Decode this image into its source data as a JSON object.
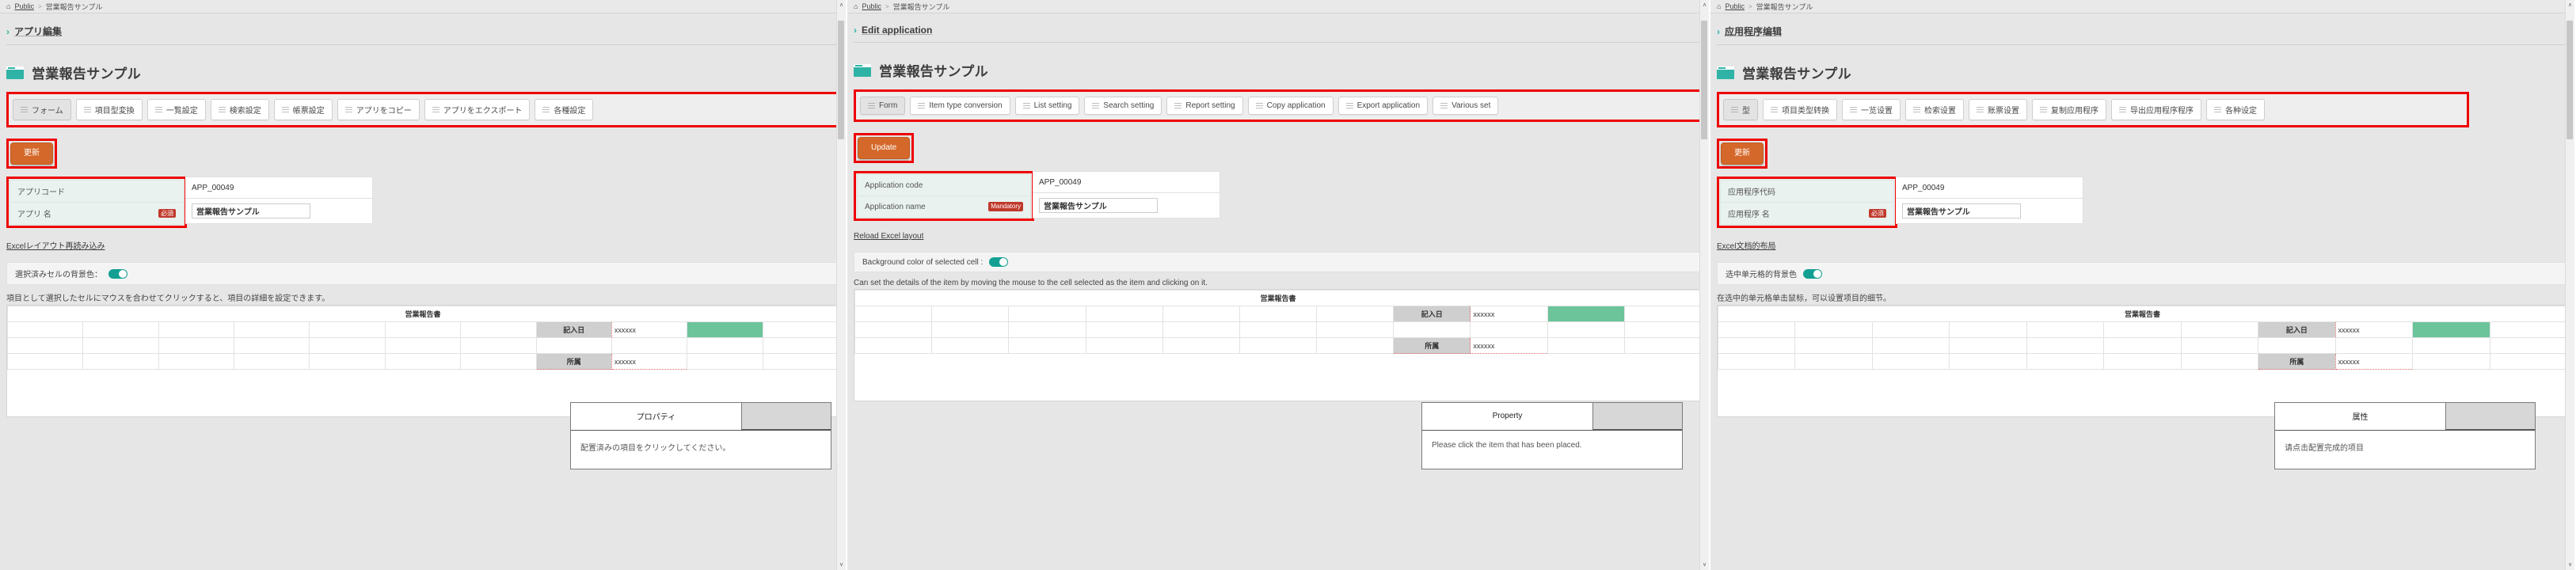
{
  "panels": [
    {
      "id": "ja",
      "breadcrumb": {
        "home_icon": "home-icon",
        "root": "Public",
        "separator": ">",
        "current": "営業報告サンプル"
      },
      "section": {
        "chevron": "chevron-right-icon",
        "title": "アプリ編集"
      },
      "app": {
        "icon": "window-icon",
        "title": "営業報告サンプル"
      },
      "toolbar": {
        "buttons": [
          {
            "label": "フォーム",
            "active": true
          },
          {
            "label": "項目型変換",
            "active": false
          },
          {
            "label": "一覧設定",
            "active": false
          },
          {
            "label": "検索設定",
            "active": false
          },
          {
            "label": "帳票設定",
            "active": false
          },
          {
            "label": "アプリをコピー",
            "active": false
          },
          {
            "label": "アプリをエクスポート",
            "active": false
          },
          {
            "label": "各種設定",
            "active": false
          }
        ]
      },
      "update_button": "更新",
      "fields": [
        {
          "label": "アプリコード",
          "required_badge": "",
          "value": "APP_00049",
          "type": "text"
        },
        {
          "label": "アプリ 名",
          "required_badge": "必須",
          "value": "営業報告サンプル",
          "type": "input"
        }
      ],
      "reload_link": "Excelレイアウト再読み込み",
      "toggle_label": "選択済みセルの背景色：",
      "hint": "項目として選択したセルにマウスを合わせてクリックすると、項目の詳細を設定できます。",
      "sheet": {
        "title": "営業報告書",
        "row_date_label": "記入日",
        "row_date_value": "xxxxxx",
        "row_dept_label": "所属",
        "row_dept_value": "xxxxxx"
      },
      "property": {
        "tab": "プロパティ",
        "message": "配置済みの項目をクリックしてください。"
      }
    },
    {
      "id": "en",
      "breadcrumb": {
        "home_icon": "home-icon",
        "root": "Public",
        "separator": ">",
        "current": "営業報告サンプル"
      },
      "section": {
        "chevron": "chevron-right-icon",
        "title": "Edit application"
      },
      "app": {
        "icon": "window-icon",
        "title": "営業報告サンプル"
      },
      "toolbar": {
        "buttons": [
          {
            "label": "Form",
            "active": true
          },
          {
            "label": "Item type conversion",
            "active": false
          },
          {
            "label": "List setting",
            "active": false
          },
          {
            "label": "Search setting",
            "active": false
          },
          {
            "label": "Report setting",
            "active": false
          },
          {
            "label": "Copy application",
            "active": false
          },
          {
            "label": "Export application",
            "active": false
          },
          {
            "label": "Various set",
            "active": false
          }
        ]
      },
      "update_button": "Update",
      "fields": [
        {
          "label": "Application code",
          "required_badge": "",
          "value": "APP_00049",
          "type": "text"
        },
        {
          "label": "Application name",
          "required_badge": "Mandatory",
          "value": "営業報告サンプル",
          "type": "input"
        }
      ],
      "reload_link": "Reload Excel layout",
      "toggle_label": "Background color of selected cell :",
      "hint": "Can set the details of the item by moving the mouse to the cell selected as the item and clicking on it.",
      "sheet": {
        "title": "営業報告書",
        "row_date_label": "記入日",
        "row_date_value": "xxxxxx",
        "row_dept_label": "所属",
        "row_dept_value": "xxxxxx"
      },
      "property": {
        "tab": "Property",
        "message": "Please click the item that has been placed."
      }
    },
    {
      "id": "zh",
      "breadcrumb": {
        "home_icon": "home-icon",
        "root": "Public",
        "separator": ">",
        "current": "営業報告サンプル"
      },
      "section": {
        "chevron": "chevron-right-icon",
        "title": "应用程序编辑"
      },
      "app": {
        "icon": "window-icon",
        "title": "営業報告サンプル"
      },
      "toolbar": {
        "buttons": [
          {
            "label": "型",
            "active": true
          },
          {
            "label": "项目类型转换",
            "active": false
          },
          {
            "label": "一览设置",
            "active": false
          },
          {
            "label": "检索设置",
            "active": false
          },
          {
            "label": "账票设置",
            "active": false
          },
          {
            "label": "复制应用程序",
            "active": false
          },
          {
            "label": "导出应用程序程序",
            "active": false
          },
          {
            "label": "各种设定",
            "active": false
          }
        ]
      },
      "update_button": "更新",
      "fields": [
        {
          "label": "应用程序代码",
          "required_badge": "",
          "value": "APP_00049",
          "type": "text"
        },
        {
          "label": "应用程序 名",
          "required_badge": "必须",
          "value": "営業報告サンプル",
          "type": "input"
        }
      ],
      "reload_link": "Excel文档的布局",
      "toggle_label": "选中单元格的背景色",
      "hint": "在选中的单元格单击鼠标，可以设置项目的细节。",
      "sheet": {
        "title": "営業報告書",
        "row_date_label": "記入日",
        "row_date_value": "xxxxxx",
        "row_dept_label": "所属",
        "row_dept_value": "xxxxxx"
      },
      "property": {
        "tab": "属性",
        "message": "请点击配置完成的项目"
      }
    }
  ],
  "colors": {
    "accent_teal": "#2fb3a6",
    "update_orange": "#d4682a",
    "highlight_red": "#ee0000",
    "required_red": "#c0392b",
    "page_bg": "#e6e6e6"
  },
  "icons": {
    "list_lines": "list-lines-icon",
    "scroll_up": "∧",
    "scroll_down": "∨"
  }
}
